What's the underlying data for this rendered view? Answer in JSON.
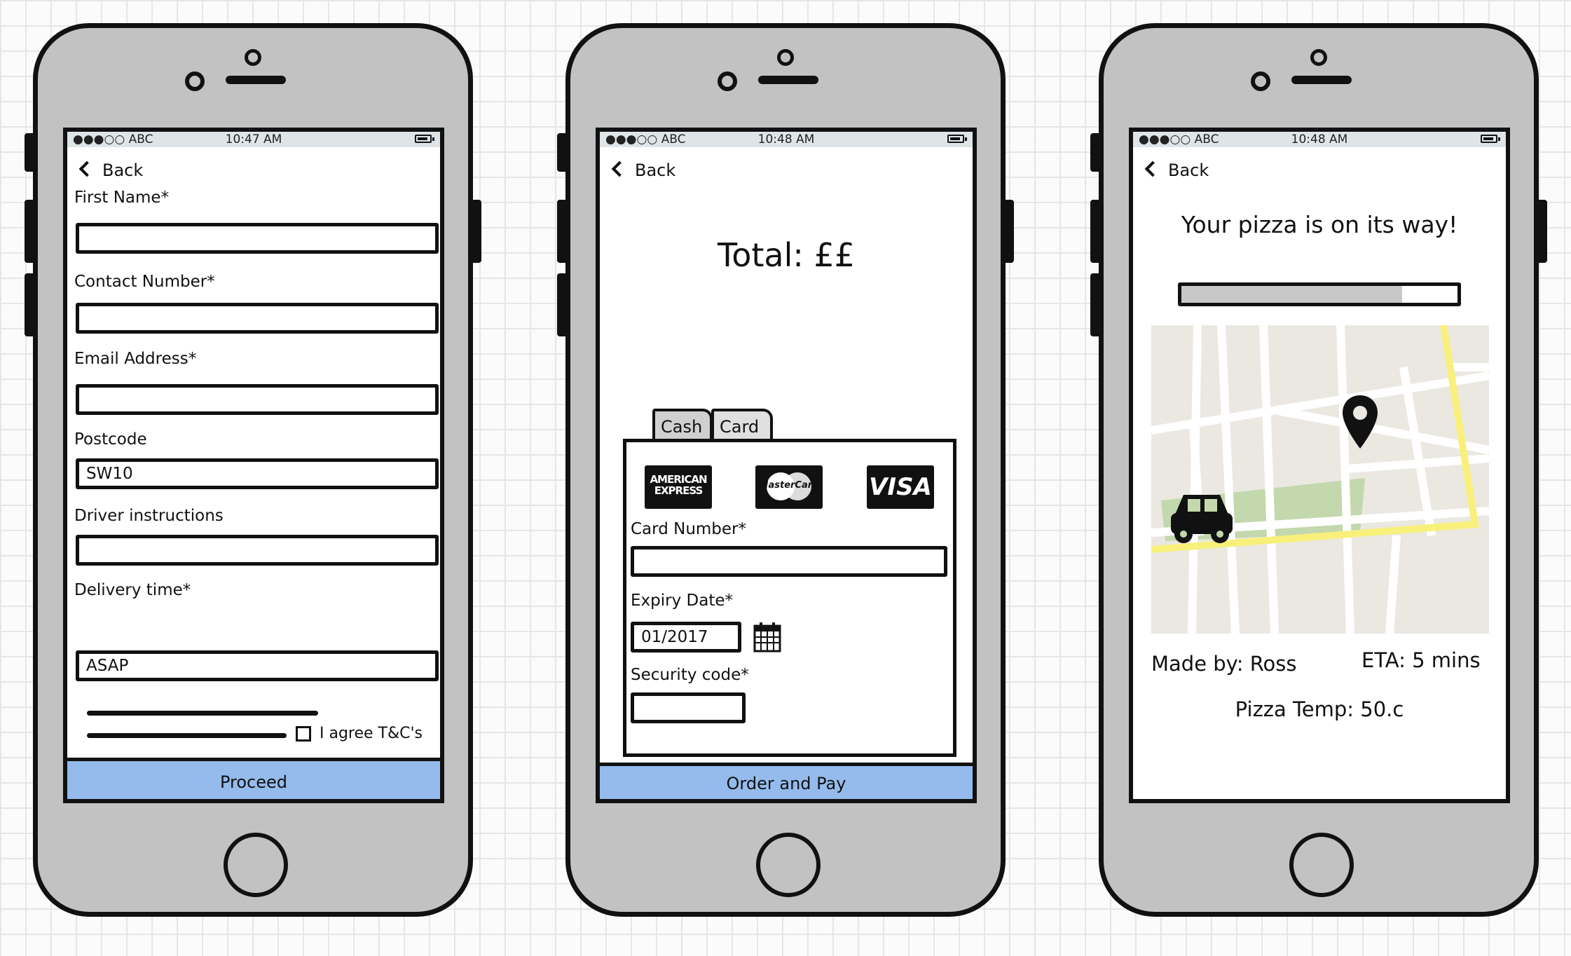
{
  "colors": {
    "button_fill": "#94bbec",
    "phone_body": "#c2c2c2",
    "status_bar": "#dfe4e7",
    "map_background": "#ebe8e1",
    "park": "#c3d8ad",
    "route": "#f8f07a",
    "progress_fill": "#c8c8c8"
  },
  "phones": [
    {
      "status": {
        "carrier": "●●●○○ ABC",
        "time": "10:47 AM"
      },
      "back_label": "Back",
      "form": {
        "first_name": {
          "label": "First Name*",
          "value": ""
        },
        "contact_number": {
          "label": "Contact Number*",
          "value": ""
        },
        "email_address": {
          "label": "Email Address*",
          "value": ""
        },
        "postcode": {
          "label": "Postcode",
          "value": "SW10"
        },
        "driver_instructions": {
          "label": "Driver instructions",
          "value": ""
        },
        "delivery_time": {
          "label": "Delivery time*",
          "value": "ASAP"
        },
        "agree_label": "I agree T&C's"
      },
      "proceed_label": "Proceed"
    },
    {
      "status": {
        "carrier": "●●●○○ ABC",
        "time": "10:48 AM"
      },
      "back_label": "Back",
      "total_label": "Total: ££",
      "tabs": [
        "Cash",
        "Card"
      ],
      "card_logos": {
        "amex_line1": "AMERICAN",
        "amex_line2": "EXPRESS",
        "mastercard": "MasterCard",
        "visa": "VISA"
      },
      "card_number": {
        "label": "Card Number*",
        "value": ""
      },
      "expiry_date": {
        "label": "Expiry Date*",
        "value": "01/2017"
      },
      "security_code": {
        "label": "Security code*",
        "value": ""
      },
      "order_label": "Order and Pay"
    },
    {
      "status": {
        "carrier": "●●●○○ ABC",
        "time": "10:48 AM"
      },
      "back_label": "Back",
      "heading": "Your pizza is on its way!",
      "progress": 0.8,
      "made_by": "Made by: Ross",
      "eta": "ETA: 5 mins",
      "pizza_temp": "Pizza Temp: 50.c",
      "icons": {
        "destination": "map-pin-icon",
        "driver": "car-icon"
      }
    }
  ]
}
